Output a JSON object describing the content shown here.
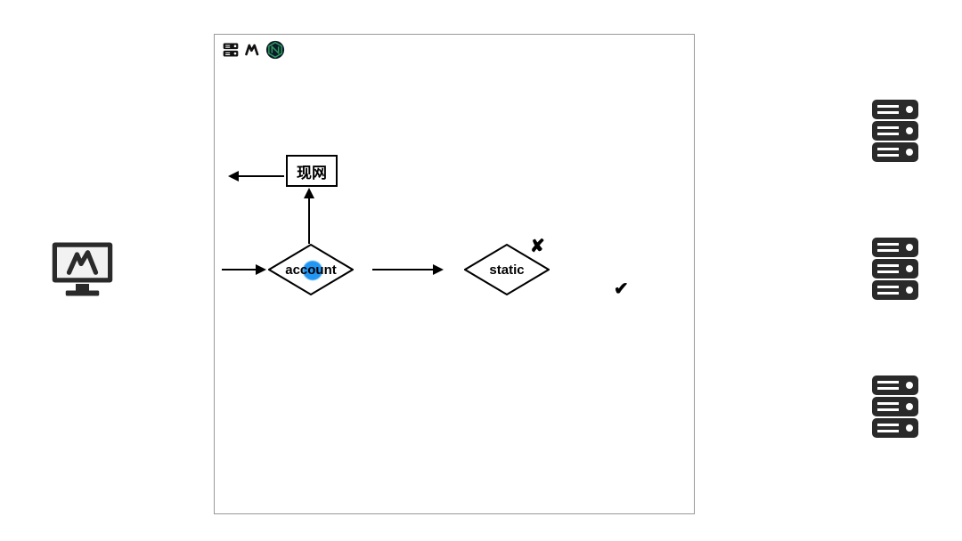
{
  "client": {
    "icon": "monitor-w-icon"
  },
  "servers": {
    "icon": "server-icon",
    "count": 3
  },
  "frame": {
    "corner_icons": [
      "server-small-icon",
      "w-small-icon",
      "n-hex-icon"
    ],
    "nodes": {
      "live_net": {
        "label": "现网"
      },
      "account": {
        "label": "account"
      },
      "static": {
        "label": "static"
      }
    },
    "edges": {
      "into_account": {},
      "account_to_live_fail": {
        "label": "✘"
      },
      "live_out": {},
      "account_to_static_ok": {
        "label": "✔"
      }
    }
  }
}
